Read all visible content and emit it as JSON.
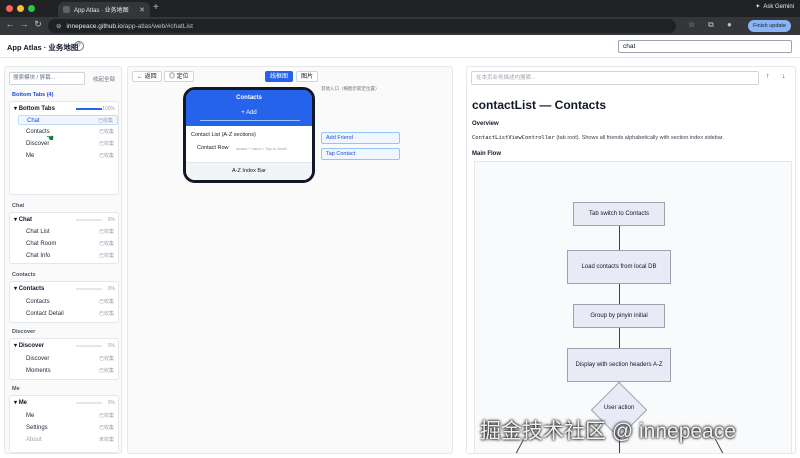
{
  "browser": {
    "tab_title": "App Atlas · 业务地图",
    "url_host": "innepeace.github.io",
    "url_path": "/app-atlas/web/#chatList",
    "ask_gemini": "Ask Gemini",
    "finish_update": "Finish update",
    "new_tab": "+"
  },
  "header": {
    "title": "App Atlas · 业务地图",
    "help": "?",
    "search_value": "chat"
  },
  "sidebar": {
    "search_placeholder": "搜索模块 / 屏幕...",
    "collapse_all": "收起全部",
    "sections": [
      {
        "title": "Bottom Tabs (4)",
        "group": "Bottom Tabs",
        "pct": "100%",
        "progress": 1.0,
        "items": [
          {
            "label": "Chat",
            "status": "已收集"
          },
          {
            "label": "Contacts",
            "status": "已收集"
          },
          {
            "label": "Discover",
            "status": "已收集"
          },
          {
            "label": "Me",
            "status": "已收集"
          }
        ]
      },
      {
        "title": "Chat",
        "group": "Chat",
        "pct": "0%",
        "progress": 0.0,
        "items": [
          {
            "label": "Chat List",
            "status": "已收集"
          },
          {
            "label": "Chat Room",
            "status": "已收集"
          },
          {
            "label": "Chat Info",
            "status": "已收集"
          }
        ]
      },
      {
        "title": "Contacts",
        "group": "Contacts",
        "pct": "0%",
        "progress": 0.0,
        "items": [
          {
            "label": "Contacts",
            "status": "已收集"
          },
          {
            "label": "Contact Detail",
            "status": "已收集"
          }
        ]
      },
      {
        "title": "Discover",
        "group": "Discover",
        "pct": "0%",
        "progress": 0.0,
        "items": [
          {
            "label": "Discover",
            "status": "已收集"
          },
          {
            "label": "Moments",
            "status": "已收集"
          }
        ]
      },
      {
        "title": "Me",
        "group": "Me",
        "pct": "0%",
        "progress": 0.0,
        "items": [
          {
            "label": "Me",
            "status": "已收集"
          },
          {
            "label": "Settings",
            "status": "已收集"
          },
          {
            "label": "About",
            "status": "未收集"
          }
        ]
      }
    ]
  },
  "canvas": {
    "back": "← 返回",
    "locate": "◎ 定位",
    "wireframe": "线框图",
    "image": "图片",
    "phone": {
      "title": "Contacts",
      "add": "+ Add",
      "list_label": "Contact List (A-Z sections)",
      "row_label": "Contact Row",
      "row_note": "avatar + name • Tap to detail",
      "footer": "A-Z Index Bar"
    },
    "entry_title": "其他入口（横图示箭定位置）",
    "entries": [
      "Add Friend",
      "Tap Contact"
    ]
  },
  "panel": {
    "search_placeholder": "在本页业务描述内搜索...",
    "prev": "↑",
    "next": "↓",
    "title": "contactList — Contacts",
    "overview_heading": "Overview",
    "overview_code": "ContactListViewController",
    "overview_text": " (tab root). Shows all friends alphabetically with section index sidebar.",
    "flow_heading": "Main Flow",
    "flow_nodes": [
      "Tab switch to Contacts",
      "Load contacts from local DB",
      "Group by pinyin initial",
      "Display with section headers A-Z",
      "User action"
    ]
  },
  "watermark": "掘金技术社区 @ innepeace",
  "colors": {
    "accent": "#2563eb",
    "flow_node": "#e8eaf6",
    "finish_update": "#8ab4f8"
  }
}
